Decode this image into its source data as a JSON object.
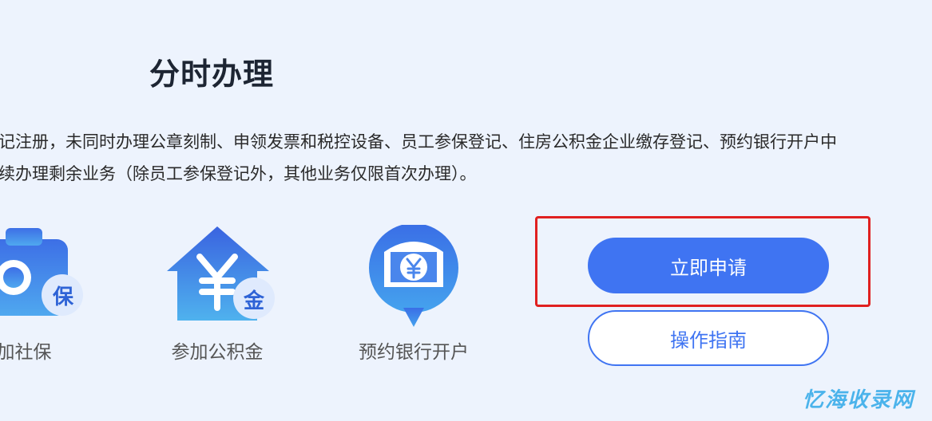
{
  "section": {
    "title": "分时办理",
    "description": [
      "记注册，未同时办理公章刻制、申领发票和税控设备、员工参保登记、住房公积金企业缴存登记、预约银行开户中",
      "续办理剩余业务（除员工参保登记外，其他业务仅限首次办理）。"
    ]
  },
  "services": [
    {
      "label": "加社保",
      "badge": "保",
      "icon": "social-insurance-icon"
    },
    {
      "label": "参加公积金",
      "badge": "金",
      "icon": "housing-fund-icon"
    },
    {
      "label": "预约银行开户",
      "icon": "bank-account-icon"
    }
  ],
  "actions": {
    "apply_label": "立即申请",
    "guide_label": "操作指南"
  },
  "watermark": "忆海收录网",
  "colors": {
    "background": "#edf3fd",
    "primary": "#3f74f2",
    "highlight_border": "#e02020"
  }
}
